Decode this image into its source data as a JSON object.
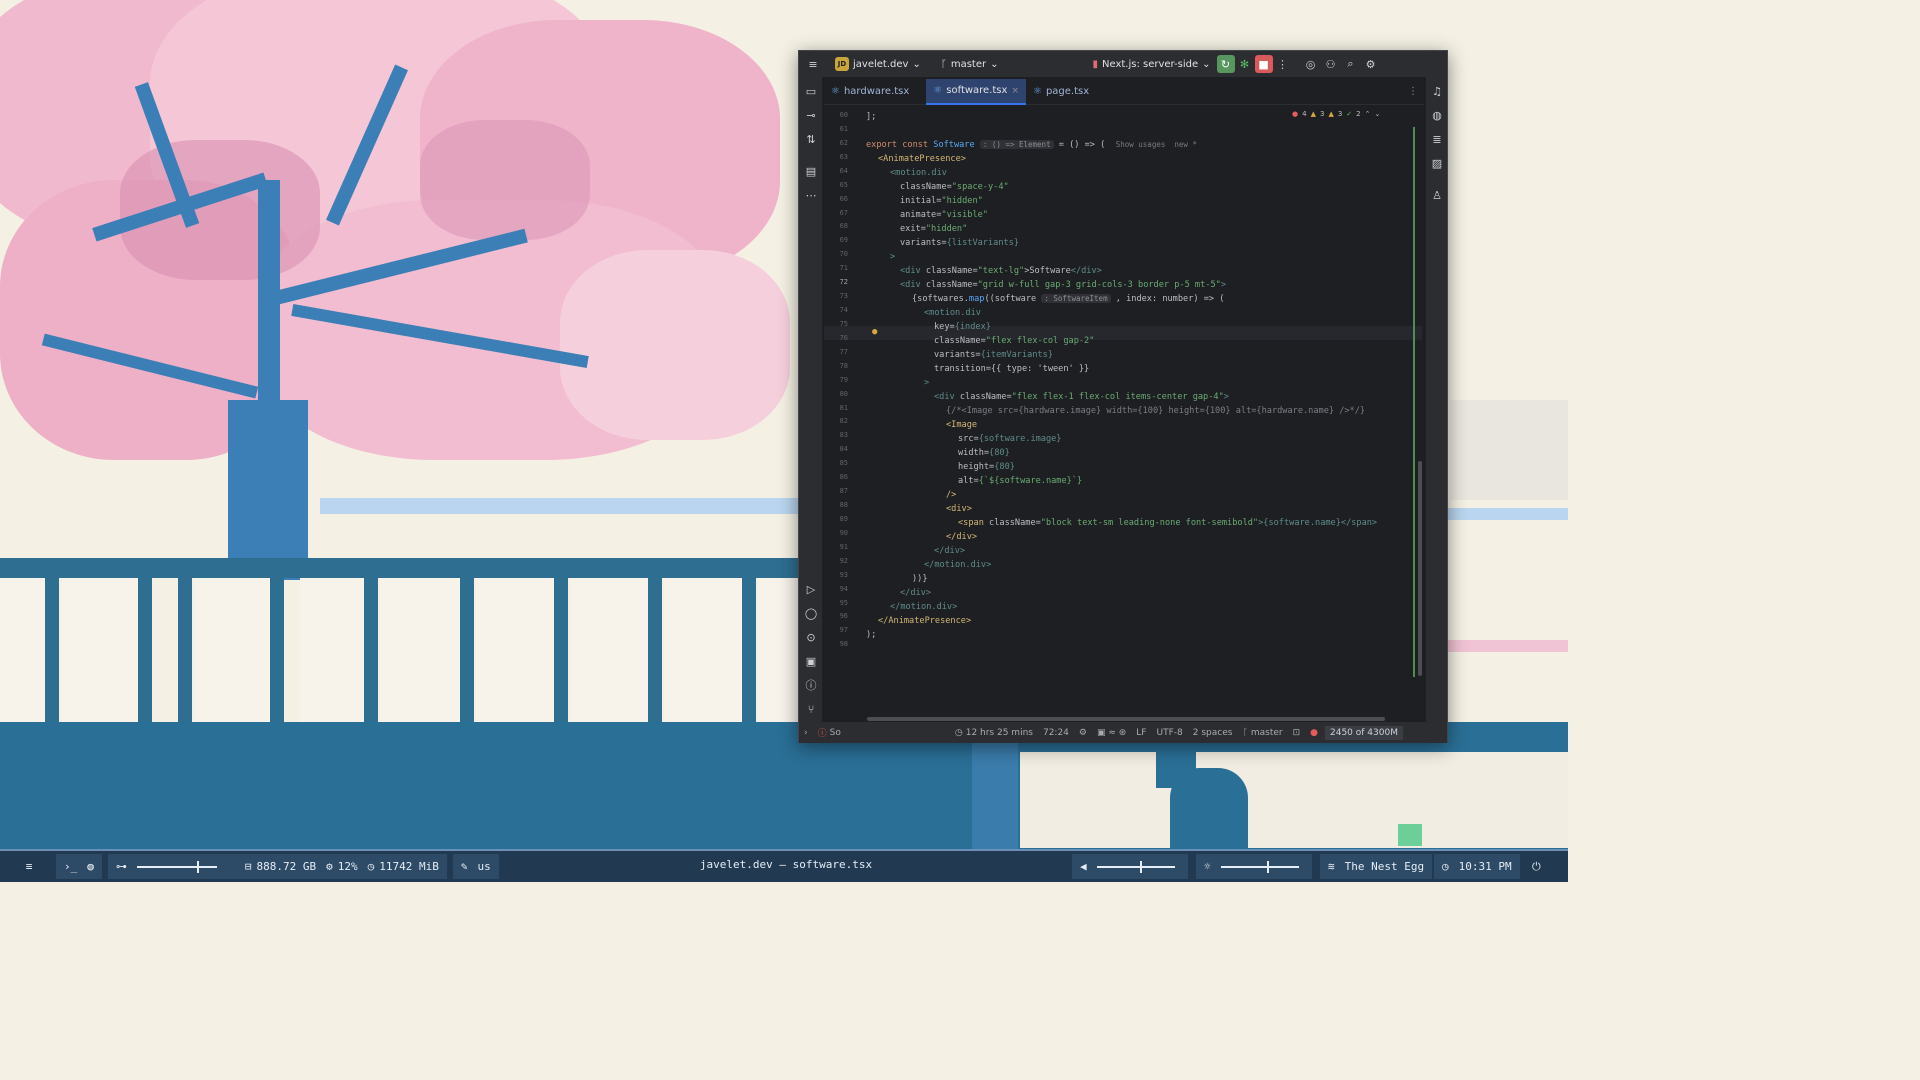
{
  "ide": {
    "project": "javelet.dev",
    "project_badge": "JD",
    "branch": "master",
    "run_config": "Next.js: server-side",
    "tabs": [
      {
        "label": "hardware.tsx",
        "active": false
      },
      {
        "label": "software.tsx",
        "active": true
      },
      {
        "label": "page.tsx",
        "active": false
      }
    ],
    "inspections": {
      "errors": "4",
      "warnings": "3",
      "weak": "3",
      "ok": "2"
    },
    "lines": [
      {
        "n": "60"
      },
      {
        "n": "61"
      },
      {
        "n": "62"
      },
      {
        "n": "63"
      },
      {
        "n": "64"
      },
      {
        "n": "65"
      },
      {
        "n": "66"
      },
      {
        "n": "67"
      },
      {
        "n": "68"
      },
      {
        "n": "69"
      },
      {
        "n": "70"
      },
      {
        "n": "71"
      },
      {
        "n": "72"
      },
      {
        "n": "73"
      },
      {
        "n": "74"
      },
      {
        "n": "75"
      },
      {
        "n": "76"
      },
      {
        "n": "77"
      },
      {
        "n": "78"
      },
      {
        "n": "79"
      },
      {
        "n": "80"
      },
      {
        "n": "81"
      },
      {
        "n": "82"
      },
      {
        "n": "83"
      },
      {
        "n": "84"
      },
      {
        "n": "85"
      },
      {
        "n": "86"
      },
      {
        "n": "87"
      },
      {
        "n": "88"
      },
      {
        "n": "89"
      },
      {
        "n": "90"
      },
      {
        "n": "91"
      },
      {
        "n": "92"
      },
      {
        "n": "93"
      },
      {
        "n": "94"
      },
      {
        "n": "95"
      },
      {
        "n": "96"
      },
      {
        "n": "97"
      },
      {
        "n": "98"
      }
    ],
    "code": {
      "l60": "];",
      "l62_export": "export const ",
      "l62_name": "Software",
      "l62_hint": ": () => Element",
      "l62_rest": " = () => (",
      "l62_usages": "Show usages  new *",
      "l63": "<AnimatePresence>",
      "l64": "<motion.div",
      "l65_attr": "className=",
      "l65_val": "\"space-y-4\"",
      "l66_attr": "initial=",
      "l66_val": "\"hidden\"",
      "l67_attr": "animate=",
      "l67_val": "\"visible\"",
      "l68_attr": "exit=",
      "l68_val": "\"hidden\"",
      "l69_attr": "variants=",
      "l69_val": "{listVariants}",
      "l70": ">",
      "l71_open": "<div ",
      "l71_attr": "className=",
      "l71_val": "\"text-lg\"",
      "l71_text": ">Software",
      "l71_close": "</div>",
      "l72_open": "<div ",
      "l72_attr": "className=",
      "l72_val": "\"grid w-full gap-3 grid-cols-3 border p-5 mt-5\"",
      "l72_close": ">",
      "l73_a": "{softwares.",
      "l73_fn": "map",
      "l73_b": "((software ",
      "l73_hint": ": SoftwareItem",
      "l73_c": " , index: number) => (",
      "l74": "<motion.div",
      "l75_attr": "key=",
      "l75_val": "{index}",
      "l76_attr": "className=",
      "l76_val": "\"flex flex-col gap-2\"",
      "l77_attr": "variants=",
      "l77_val": "{itemVariants}",
      "l78_attr": "transition=",
      "l78_val": "{{ type: 'tween' }}",
      "l79": ">",
      "l80_open": "<div ",
      "l80_attr": "className=",
      "l80_val": "\"flex flex-1 flex-col items-center gap-4\"",
      "l80_close": ">",
      "l81": "{/*<Image src={hardware.image} width={100} height={100} alt={hardware.name} />*/}",
      "l82": "<Image",
      "l83_attr": "src=",
      "l83_val": "{software.image}",
      "l84_attr": "width=",
      "l84_val": "{80}",
      "l85_attr": "height=",
      "l85_val": "{80}",
      "l86_attr": "alt=",
      "l86_val": "{`${software.name}`}",
      "l87": "/>",
      "l88": "<div>",
      "l89_open": "<span ",
      "l89_attr": "className=",
      "l89_val": "\"block text-sm leading-none font-semibold\"",
      "l89_rest": ">{software.name}</span>",
      "l90": "</div>",
      "l91": "</div>",
      "l92": "</motion.div>",
      "l93": "))}",
      "l94": "</div>",
      "l95": "</motion.div>",
      "l96": "</AnimatePresence>",
      "l97": ");"
    },
    "status": {
      "left": "So",
      "time_spent": "12 hrs 25 mins",
      "position": "72:24",
      "line_sep": "LF",
      "encoding": "UTF-8",
      "indent": "2 spaces",
      "branch": "master",
      "memory": "2450 of 4300M"
    }
  },
  "taskbar": {
    "storage": "888.72 GB",
    "cpu": "12%",
    "ram": "11742 MiB",
    "layout": "us",
    "window_title": "javelet.dev – software.tsx",
    "network": "The Nest Egg",
    "clock": "10:31 PM",
    "volume": 0.55,
    "brightness": 0.6
  },
  "colors": {
    "accent": "#3574f0",
    "taskbar_bg": "#213a52",
    "ide_bg": "#1e1f22"
  }
}
